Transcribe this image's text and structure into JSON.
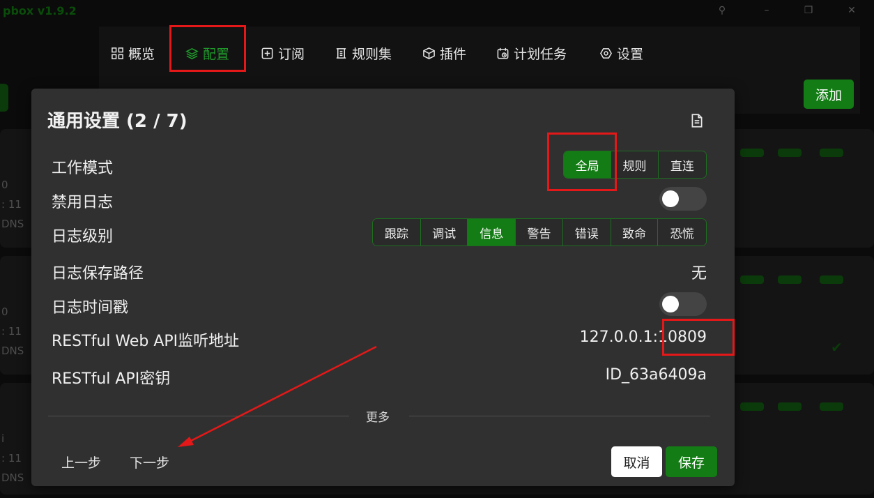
{
  "app": {
    "title": "pbox v1.9.2"
  },
  "window_controls": {
    "pin": "pin-icon",
    "minimize": "minimize-icon",
    "maximize": "maximize-icon",
    "close": "close-icon"
  },
  "background": {
    "card_text": [
      "0",
      ": 11",
      "DNS",
      "0",
      ": 11",
      "DNS",
      "i",
      ": 11",
      "DNS"
    ]
  },
  "nav": {
    "items": [
      {
        "label": "概览",
        "icon": "overview-grid-icon"
      },
      {
        "label": "配置",
        "icon": "layers-icon",
        "active": true
      },
      {
        "label": "订阅",
        "icon": "subscribe-plus-icon"
      },
      {
        "label": "规则集",
        "icon": "ruleset-icon"
      },
      {
        "label": "插件",
        "icon": "plugin-box-icon"
      },
      {
        "label": "计划任务",
        "icon": "schedule-calendar-icon"
      },
      {
        "label": "设置",
        "icon": "settings-gear-icon"
      }
    ],
    "add_label": "添加"
  },
  "modal": {
    "title": "通用设置 (2 / 7)",
    "rows": {
      "work_mode": {
        "label": "工作模式",
        "options": [
          "全局",
          "规则",
          "直连"
        ],
        "selected": "全局"
      },
      "disable_log": {
        "label": "禁用日志",
        "on": false
      },
      "log_level": {
        "label": "日志级别",
        "options": [
          "跟踪",
          "调试",
          "信息",
          "警告",
          "错误",
          "致命",
          "恐慌"
        ],
        "selected": "信息"
      },
      "log_path": {
        "label": "日志保存路径",
        "value": "无"
      },
      "log_timestamp": {
        "label": "日志时间戳",
        "on": false
      },
      "restful_addr": {
        "label": "RESTful Web API监听地址",
        "value": "127.0.0.1:10809"
      },
      "restful_key": {
        "label": "RESTful API密钥",
        "value": "ID_63a6409a"
      }
    },
    "more_label": "更多",
    "prev_label": "上一步",
    "next_label": "下一步",
    "cancel_label": "取消",
    "save_label": "保存"
  },
  "colors": {
    "accent": "#137c14",
    "annotation": "#e41818",
    "modal_bg": "#303030"
  }
}
